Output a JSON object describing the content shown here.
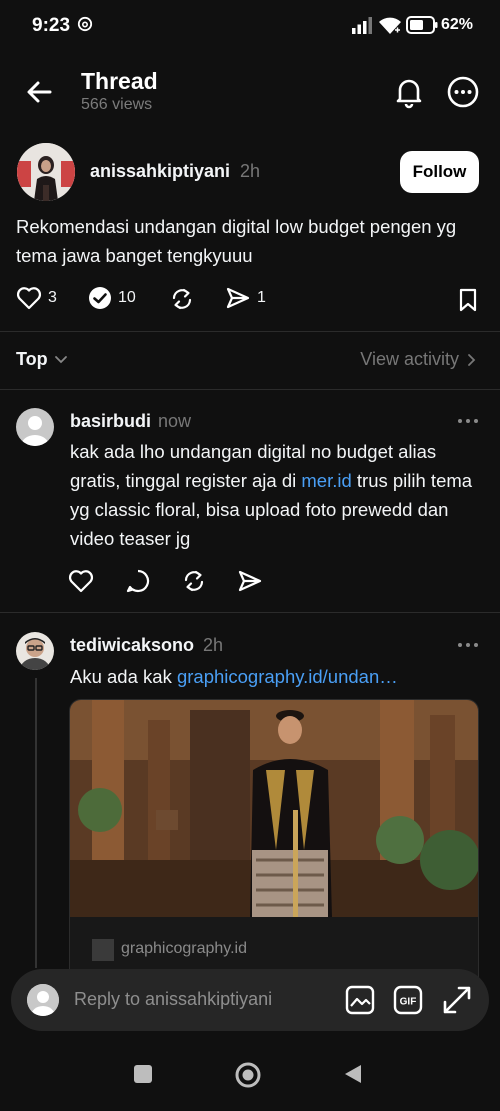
{
  "status_bar": {
    "time": "9:23",
    "battery_percent": "62%",
    "battery_level": 0.62
  },
  "header": {
    "title": "Thread",
    "views": "566 views"
  },
  "original_post": {
    "username": "anissahkiptiyani",
    "time": "2h",
    "follow_label": "Follow",
    "text": "Rekomendasi undangan digital low budget pengen yg tema jawa banget  tengkyuuu",
    "likes": "3",
    "replies": "10",
    "shares": "1"
  },
  "sort": {
    "label": "Top",
    "view_activity": "View activity"
  },
  "replies": [
    {
      "username": "basirbudi",
      "time": "now",
      "text_before": "kak ada lho undangan digital no budget alias gratis, tinggal register aja di ",
      "link": "mer.id",
      "text_after": " trus pilih tema yg classic floral, bisa upload foto prewedd dan video teaser jg"
    },
    {
      "username": "tediwicaksono",
      "time": "2h",
      "text_before": "Aku ada kak ",
      "link": "graphicography.id/undan…",
      "card_domain": "graphicography.id"
    }
  ],
  "reply_bar": {
    "placeholder": "Reply to anissahkiptiyani"
  },
  "colors": {
    "background": "#101010",
    "link": "#4a9ff5",
    "muted": "#777777"
  }
}
